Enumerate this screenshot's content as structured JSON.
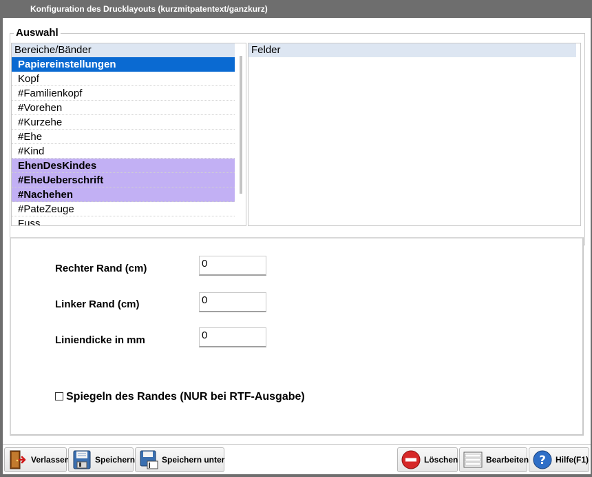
{
  "window": {
    "title": "Konfiguration des Drucklayouts (kurzmitpatentext/ganzkurz)"
  },
  "auswahl": {
    "legend": "Auswahl",
    "list_header": "Bereiche/Bänder",
    "items": [
      {
        "label": "Papiereinstellungen",
        "state": "selected"
      },
      {
        "label": "Kopf",
        "state": "normal"
      },
      {
        "label": "#Familienkopf",
        "state": "normal"
      },
      {
        "label": "#Vorehen",
        "state": "normal"
      },
      {
        "label": "#Kurzehe",
        "state": "normal"
      },
      {
        "label": "#Ehe",
        "state": "normal"
      },
      {
        "label": "#Kind",
        "state": "normal"
      },
      {
        "label": "EhenDesKindes",
        "state": "highlight"
      },
      {
        "label": "#EheUeberschrift",
        "state": "highlight"
      },
      {
        "label": "#Nachehen",
        "state": "highlight"
      },
      {
        "label": "#PateZeuge",
        "state": "normal"
      },
      {
        "label": "Fuss",
        "state": "normal"
      }
    ],
    "fields_header": "Felder"
  },
  "settings": {
    "right_margin_label": "Rechter Rand (cm)",
    "right_margin_value": "0",
    "left_margin_label": "Linker Rand (cm)",
    "left_margin_value": "0",
    "line_width_label": "Liniendicke in mm",
    "line_width_value": "0",
    "mirror_label": "Spiegeln des Randes (NUR bei RTF-Ausgabe)",
    "mirror_checked": false
  },
  "toolbar": {
    "exit_label": "Verlassen",
    "save_label": "Speichern",
    "save_as_label": "Speichern unter",
    "delete_label": "Löschen",
    "edit_label": "Bearbeiten",
    "help_label": "Hilfe(F1)"
  },
  "icons": {
    "exit": "door-exit-icon",
    "save": "floppy-disk-icon",
    "save_as": "floppy-disk-edit-icon",
    "delete": "red-minus-circle-icon",
    "edit": "document-list-icon",
    "help": "blue-question-circle-icon"
  },
  "colors": {
    "selection": "#0a6ad2",
    "highlight": "#c2b0f4",
    "header_bg": "#dde6f2",
    "titlebar": "#6e6e6e"
  }
}
